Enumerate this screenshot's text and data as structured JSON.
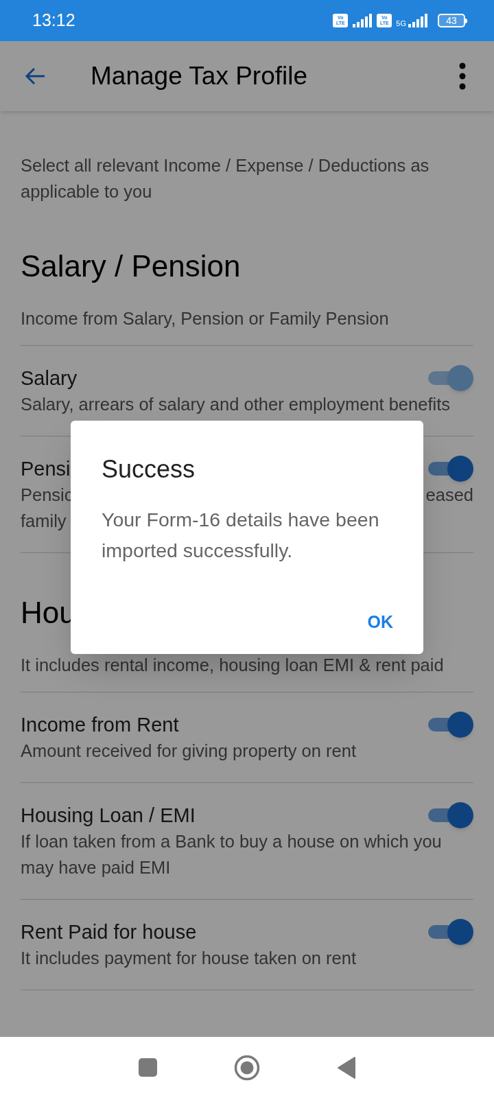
{
  "status_bar": {
    "time": "13:12",
    "sim_badges": [
      {
        "top": "Vo",
        "bottom": "LTE"
      },
      {
        "top": "Vo",
        "bottom": "LTE"
      }
    ],
    "network": "5G",
    "battery": "43"
  },
  "app_bar": {
    "title": "Manage Tax Profile"
  },
  "intro": "Select all relevant Income / Expense / Deductions as applicable to you",
  "sections": [
    {
      "heading": "Salary / Pension",
      "subtitle": "Income from Salary, Pension or Family Pension",
      "items": [
        {
          "title": "Salary",
          "description": "Salary, arrears of salary and other employment benefits",
          "on": true,
          "disabled": true
        },
        {
          "title": "Pensi",
          "description": "Pensic",
          "description_right": "eased",
          "description_line2": "family",
          "on": true,
          "disabled": false
        }
      ]
    },
    {
      "heading": "Hou",
      "subtitle": "It includes rental income, housing loan EMI & rent paid",
      "items": [
        {
          "title": "Income from Rent",
          "description": "Amount received for giving property on rent",
          "on": true,
          "disabled": false
        },
        {
          "title": "Housing Loan / EMI",
          "description": "If loan taken from a Bank to buy a house on which you may have paid EMI",
          "on": true,
          "disabled": false
        },
        {
          "title": "Rent Paid for house",
          "description": "It includes payment for house taken on rent",
          "on": true,
          "disabled": false
        }
      ]
    }
  ],
  "dialog": {
    "title": "Success",
    "message": "Your Form-16 details have been imported successfully.",
    "button": "OK"
  }
}
